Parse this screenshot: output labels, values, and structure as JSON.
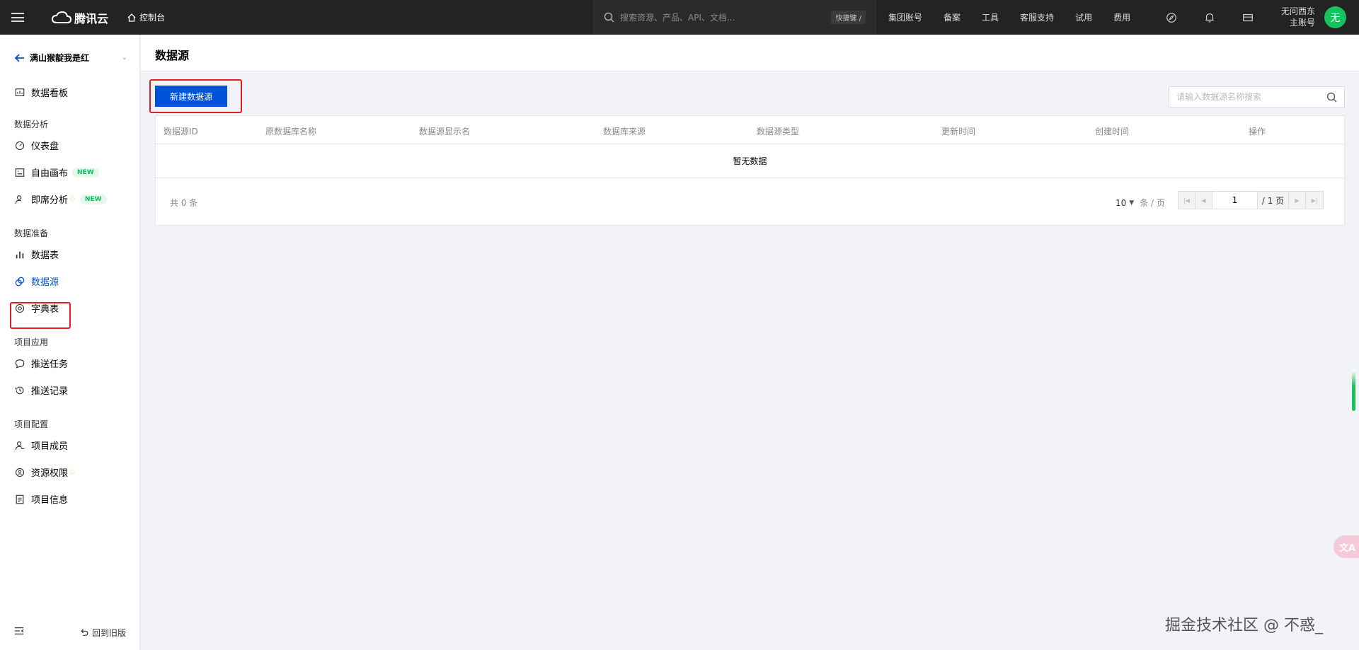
{
  "topbar": {
    "logo_text": "腾讯云",
    "console_label": "控制台",
    "search_placeholder": "搜索资源、产品、API、文档...",
    "shortcut": "快捷键 /",
    "links": [
      "集团账号",
      "备案",
      "工具",
      "客服支持",
      "试用",
      "费用"
    ],
    "user_line1": "无问西东",
    "user_line2": "主账号",
    "avatar_text": "无",
    "avatar_color": "#16c25e"
  },
  "sidebar": {
    "project_name": "满山猴靛我是红",
    "dashboard": "数据看板",
    "groups": {
      "analysis": "数据分析",
      "prep": "数据准备",
      "app": "项目应用",
      "config": "项目配置"
    },
    "items": {
      "instrument": "仪表盘",
      "canvas": "自由画布",
      "adhoc": "即席分析",
      "tables": "数据表",
      "datasource": "数据源",
      "dict": "字典表",
      "push_task": "推送任务",
      "push_log": "推送记录",
      "members": "项目成员",
      "permissions": "资源权限",
      "info": "项目信息"
    },
    "new_badge": "NEW",
    "back_old": "回到旧版"
  },
  "main": {
    "title": "数据源",
    "new_button": "新建数据源",
    "search_placeholder": "请输入数据源名称搜索",
    "columns": [
      "数据源ID",
      "原数据库名称",
      "数据源显示名",
      "数据库来源",
      "数据源类型",
      "更新时间",
      "创建时间",
      "操作"
    ],
    "empty_text": "暂无数据",
    "total_text": "共  0  条",
    "page_size": "10",
    "page_size_unit": "条 / 页",
    "current_page": "1",
    "total_pages": "/ 1 页"
  },
  "watermark": "掘金技术社区 @ 不惑_",
  "accent_color": "#0052d9",
  "highlight_color": "#e02020"
}
